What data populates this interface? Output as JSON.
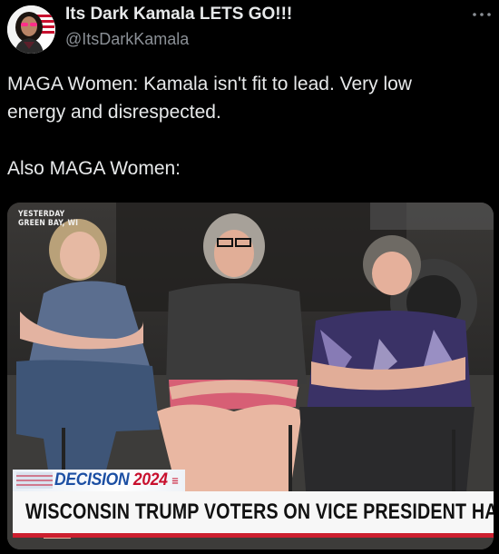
{
  "author": {
    "display_name": "Its Dark Kamala LETS GO!!!",
    "handle": "@ItsDarkKamala",
    "avatar_icon": "avatar-dark-kamala-icon"
  },
  "more_icon": "more-options-icon",
  "tweet": {
    "line1": "MAGA Women: Kamala isn't fit to lead. Very low",
    "line2": "energy and disrespected.",
    "line3": "Also MAGA Women:"
  },
  "media": {
    "tag_line1": "YESTERDAY",
    "tag_line2": "GREEN BAY, WI",
    "decision_label": "DECISION ",
    "decision_year": "2024",
    "headline": "WISCONSIN TRUMP VOTERS ON VICE PRESIDENT HARRIS"
  },
  "colors": {
    "background": "#000000",
    "text": "#e7e9ea",
    "secondary_text": "#8b9096",
    "decision_blue": "#1c4fa3",
    "chyron_red": "#cc1f2f"
  }
}
